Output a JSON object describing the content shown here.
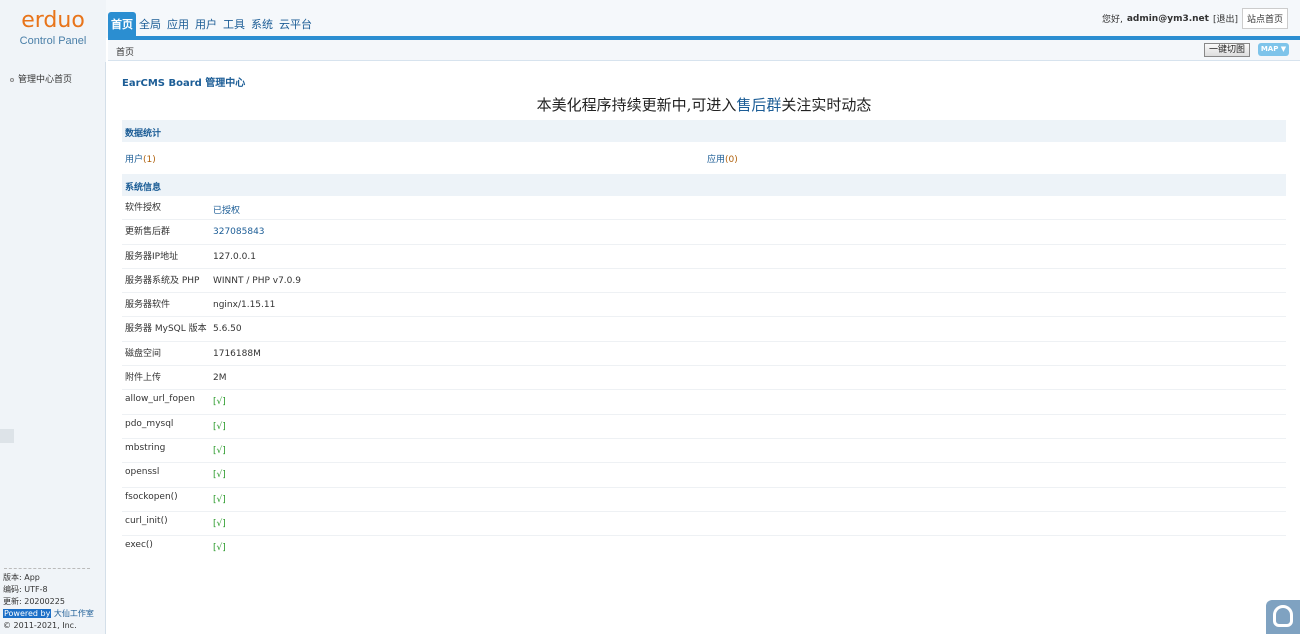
{
  "logo": {
    "brand": "erduo",
    "subtitle": "Control Panel"
  },
  "topnav": {
    "tabs": [
      {
        "label": "首页",
        "active": true
      },
      {
        "label": "全局",
        "active": false
      },
      {
        "label": "应用",
        "active": false
      },
      {
        "label": "用户",
        "active": false
      },
      {
        "label": "工具",
        "active": false
      },
      {
        "label": "系统",
        "active": false
      },
      {
        "label": "云平台",
        "active": false
      }
    ]
  },
  "topright": {
    "greeting": "您好,",
    "user": "admin@ym3.net",
    "logout": "[退出]",
    "site_home": "站点首页"
  },
  "subbar": {
    "breadcrumb": "首页",
    "onekey": "一键切图",
    "map": "MAP ▼"
  },
  "sidebar": {
    "item": "管理中心首页",
    "footer": {
      "version": "版本: App",
      "encoding": "编码: UTF-8",
      "updated": "更新: 20200225",
      "powered": "Powered by",
      "studio": "大仙工作室",
      "copyright": "© 2011-2021, Inc."
    }
  },
  "main": {
    "title": "EarCMS Board 管理中心",
    "banner": {
      "pre": "本美化程序持续更新中,可进入",
      "highlight": "售后群",
      "post": "关注实时动态"
    },
    "stats": {
      "heading": "数据统计",
      "users_label": "用户",
      "users_count": "(1)",
      "apps_label": "应用",
      "apps_count": "(0)"
    },
    "sysinfo": {
      "heading": "系统信息",
      "rows": [
        {
          "k": "软件授权",
          "v": "已授权",
          "type": "link"
        },
        {
          "k": "更新售后群",
          "v": "327085843",
          "type": "link"
        },
        {
          "k": "服务器IP地址",
          "v": "127.0.0.1",
          "type": "text"
        },
        {
          "k": "服务器系统及 PHP",
          "v": "WINNT / PHP v7.0.9",
          "type": "text"
        },
        {
          "k": "服务器软件",
          "v": "nginx/1.15.11",
          "type": "text"
        },
        {
          "k": "服务器 MySQL 版本",
          "v": "5.6.50",
          "type": "text"
        },
        {
          "k": "磁盘空间",
          "v": "1716188M",
          "type": "text"
        },
        {
          "k": "附件上传",
          "v": "2M",
          "type": "text"
        },
        {
          "k": "allow_url_fopen",
          "v": "[√]",
          "type": "ok"
        },
        {
          "k": "pdo_mysql",
          "v": "[√]",
          "type": "ok"
        },
        {
          "k": "mbstring",
          "v": "[√]",
          "type": "ok"
        },
        {
          "k": "openssl",
          "v": "[√]",
          "type": "ok"
        },
        {
          "k": "fsockopen()",
          "v": "[√]",
          "type": "ok"
        },
        {
          "k": "curl_init()",
          "v": "[√]",
          "type": "ok"
        },
        {
          "k": "exec()",
          "v": "[√]",
          "type": "ok"
        }
      ]
    }
  },
  "colors": {
    "accent": "#2b8ed1",
    "link": "#1c5d96",
    "brand": "#e8741a",
    "ok": "#2a9a2a"
  }
}
